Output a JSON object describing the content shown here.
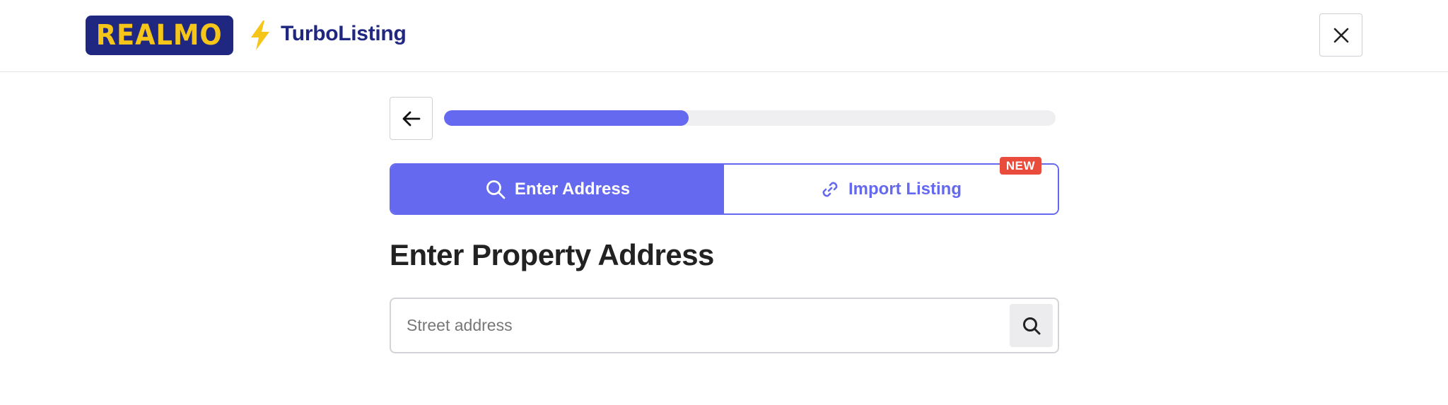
{
  "header": {
    "logo_text": "REALMO",
    "app_name": "TurboListing",
    "close_icon": "close-icon",
    "bolt_icon": "lightning-bolt-icon"
  },
  "progress": {
    "back_icon": "arrow-left-icon",
    "value_percent": 40
  },
  "tabs": [
    {
      "label": "Enter Address",
      "icon": "search-icon",
      "active": true
    },
    {
      "label": "Import Listing",
      "icon": "link-icon",
      "active": false,
      "badge": "NEW"
    }
  ],
  "main": {
    "title": "Enter Property Address",
    "search": {
      "placeholder": "Street address",
      "value": "",
      "button_icon": "search-icon"
    }
  },
  "colors": {
    "brand_navy": "#1f2780",
    "brand_yellow": "#f5c51a",
    "accent": "#6469f0",
    "badge_red": "#e94b3c"
  }
}
